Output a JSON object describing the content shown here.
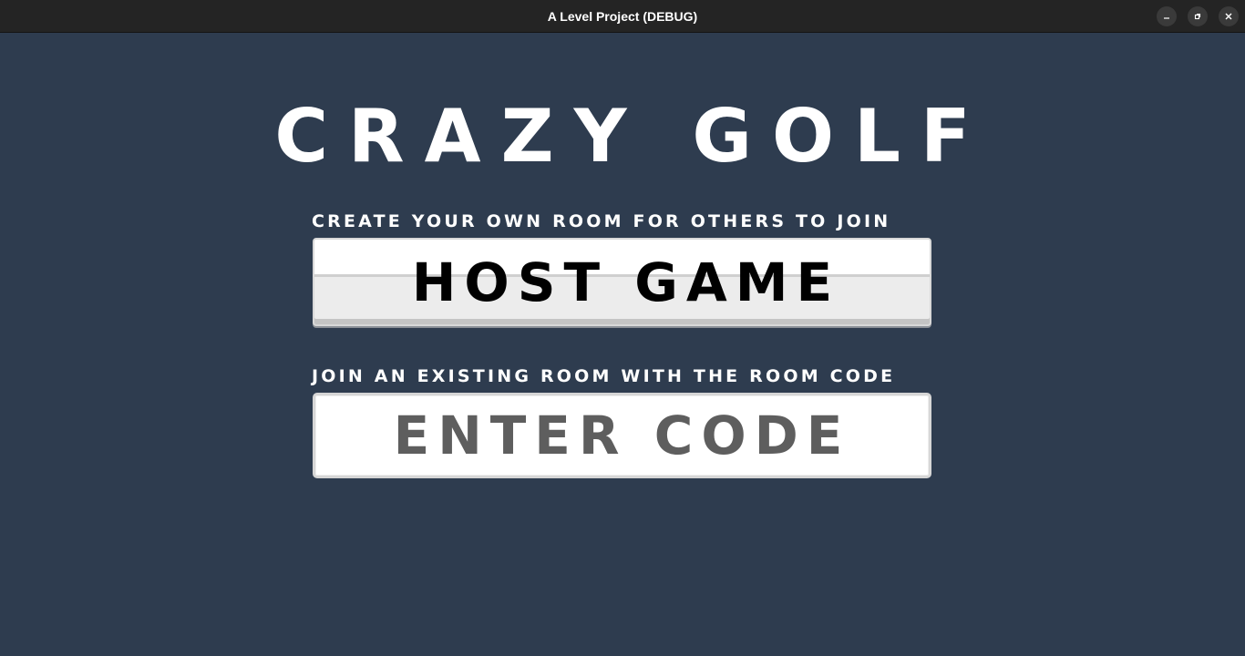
{
  "window": {
    "title": "A Level Project (DEBUG)",
    "controls": [
      "minimize-icon",
      "maximize-icon",
      "close-icon"
    ]
  },
  "main": {
    "title": "CRAZY GOLF",
    "host_caption": "CREATE YOUR OWN ROOM FOR OTHERS TO JOIN",
    "host_button_label": "HOST GAME",
    "join_caption": "JOIN AN EXISTING ROOM WITH THE ROOM CODE",
    "code_input": {
      "value": "",
      "placeholder": "ENTER CODE"
    }
  },
  "colors": {
    "background": "#2e3c4f",
    "titlebar": "#242424",
    "button_face": "#ececec",
    "input_placeholder": "#5e5e5e"
  }
}
